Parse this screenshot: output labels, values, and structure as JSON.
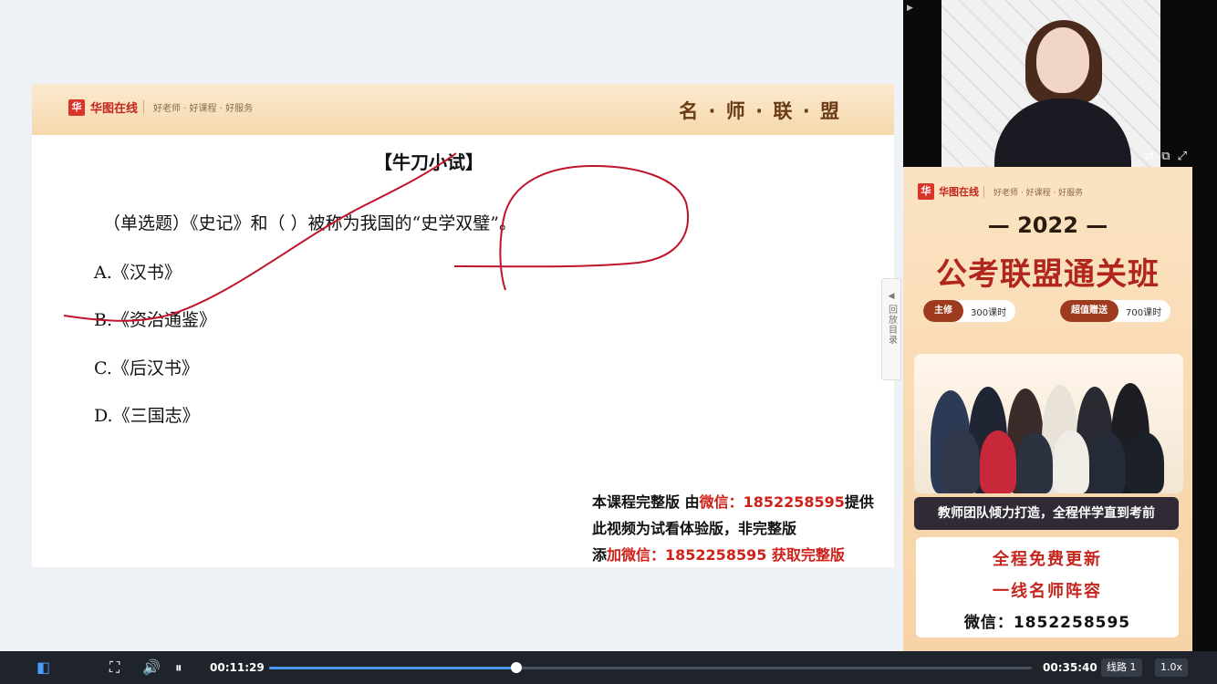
{
  "slide": {
    "logo_text": "华图在线",
    "slogan": "好老师 · 好课程 · 好服务",
    "brand": "名 · 师 · 联 · 盟",
    "title": "【牛刀小试】",
    "question": "（单选题）《史记》和（   ）被称为我国的“史学双璧”。",
    "options": [
      "A.《汉书》",
      "B.《资治通鉴》",
      "C.《后汉书》",
      "D.《三国志》"
    ]
  },
  "watermark": {
    "line1_a": "本课程完整版 由",
    "line1_red": "微信：1852258595",
    "line1_b": "提供",
    "line2": "此视频为试看体验版，非完整版",
    "line3_a": "添",
    "line3_red": "加微信：1852258595 获取完整版"
  },
  "side_tab": {
    "label": "回放目录"
  },
  "ad": {
    "logo_text": "华图在线",
    "slogan": "好老师 · 好课程 · 好服务",
    "year": "— 2022 —",
    "title": "公考联盟通关班",
    "pill1_tag": "主修",
    "pill1_val": "300课时",
    "pill2_tag": "超值赠送",
    "pill2_val": "700课时",
    "team_slogan": "教师团队倾力打造，全程伴学直到考前",
    "line1": "全程免费更新",
    "line2": "一线名师阵容",
    "wechat": "微信：1852258595"
  },
  "player": {
    "current_time": "00:11:29",
    "total_time": "00:35:40",
    "progress_fraction": 0.324,
    "line_label": "线路 1",
    "speed_label": "1.0x"
  },
  "colors": {
    "accent_red": "#d0201a",
    "progress": "#4b9bff"
  }
}
